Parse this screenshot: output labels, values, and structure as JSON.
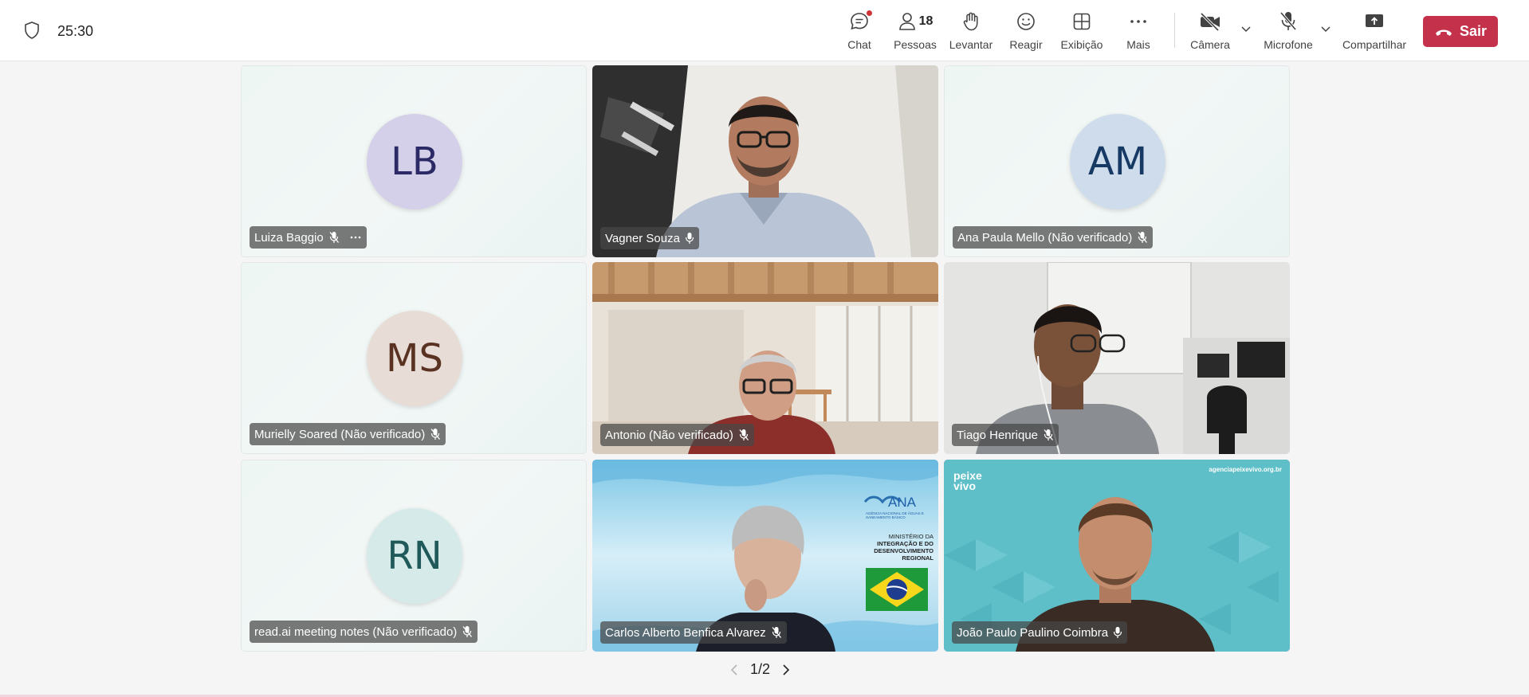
{
  "meeting": {
    "timer": "25:30"
  },
  "toolbar": {
    "chat_label": "Chat",
    "people_label": "Pessoas",
    "people_count": "18",
    "raise_label": "Levantar",
    "react_label": "Reagir",
    "view_label": "Exibição",
    "more_label": "Mais",
    "camera_label": "Câmera",
    "mic_label": "Microfone",
    "share_label": "Compartilhar",
    "leave_label": "Sair"
  },
  "tiles": [
    {
      "name": "Luiza Baggio",
      "initials": "LB",
      "avatar_bg": "#d5d0ea",
      "avatar_fg": "#2b2a66"
    },
    {
      "name": "Vagner Souza"
    },
    {
      "name": "Ana Paula Mello (Não verificado)",
      "initials": "AM",
      "avatar_bg": "#cfdceb",
      "avatar_fg": "#163a64"
    },
    {
      "name": "Murielly Soared (Não verificado)",
      "initials": "MS",
      "avatar_bg": "#e8dcd7",
      "avatar_fg": "#5a3222"
    },
    {
      "name": "Antonio (Não verificado)"
    },
    {
      "name": "Tiago Henrique"
    },
    {
      "name": "read.ai meeting notes (Não verificado)",
      "initials": "RN",
      "avatar_bg": "#d6eaea",
      "avatar_fg": "#1f5959"
    },
    {
      "name": "Carlos Alberto Benfica Alvarez"
    },
    {
      "name": "João Paulo Paulino Coimbra"
    }
  ],
  "backgrounds": {
    "carlos": {
      "ana_logo": "ANA",
      "ana_subtitle": "AGÊNCIA NACIONAL DE ÁGUAS E SANEAMENTO BÁSICO",
      "ministry_lines": [
        "MINISTÉRIO DA",
        "INTEGRAÇÃO E DO",
        "DESENVOLVIMENTO",
        "REGIONAL"
      ]
    },
    "joao": {
      "site": "agenciapeixevivo.org.br",
      "logo_line1": "peixe",
      "logo_line2": "vivo"
    }
  },
  "pager": {
    "label": "1/2"
  },
  "colors": {
    "accent": "#6264a7",
    "leave": "#c4314b"
  }
}
